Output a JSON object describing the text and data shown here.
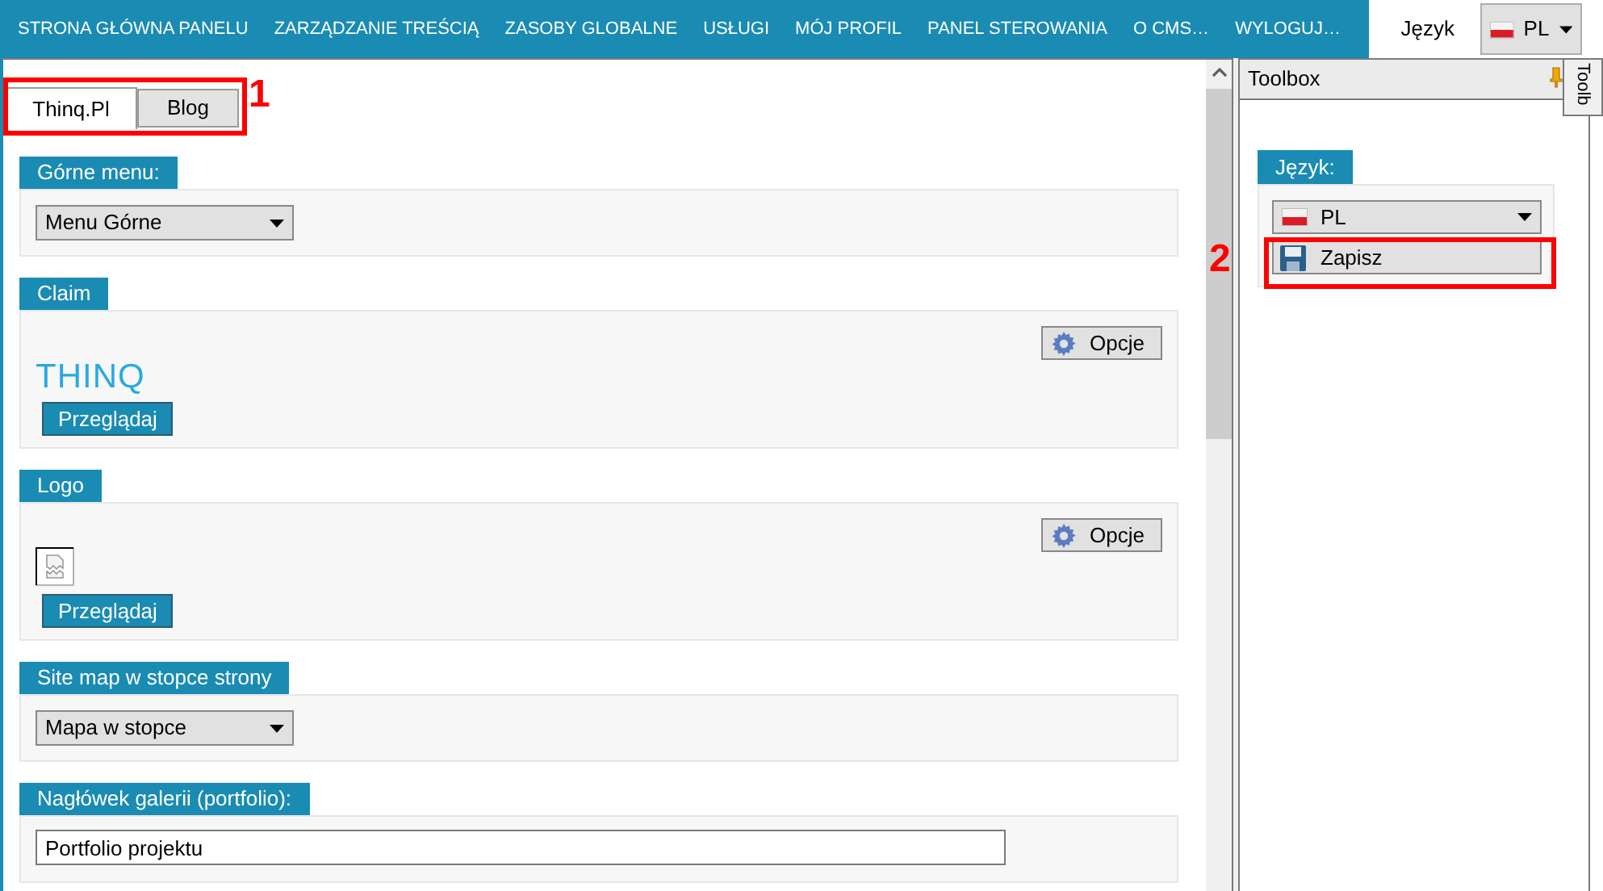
{
  "nav": {
    "items": [
      {
        "label": "STRONA GŁÓWNA PANELU"
      },
      {
        "label": "ZARZĄDZANIE TREŚCIĄ"
      },
      {
        "label": "ZASOBY GLOBALNE"
      },
      {
        "label": "USŁUGI"
      },
      {
        "label": "MÓJ PROFIL"
      },
      {
        "label": "PANEL STEROWANIA"
      },
      {
        "label": "O CMS…"
      },
      {
        "label": "WYLOGUJ…"
      }
    ],
    "language_label": "Język",
    "language": {
      "value": "PL"
    }
  },
  "tabs": [
    {
      "label": "Thinq.Pl",
      "selected": true
    },
    {
      "label": "Blog",
      "selected": false
    }
  ],
  "sections": [
    {
      "kind": "select",
      "title": "Górne menu:",
      "value": "Menu Górne"
    },
    {
      "kind": "image",
      "title": "Claim",
      "options": "Opcje",
      "preview": "THINQ",
      "browse": "Przeglądaj"
    },
    {
      "kind": "image",
      "title": "Logo",
      "options": "Opcje",
      "browse": "Przeglądaj"
    },
    {
      "kind": "select",
      "title": "Site map w stopce strony",
      "value": "Mapa w stopce"
    },
    {
      "kind": "input",
      "title": "Nagłówek galerii (portfolio):",
      "value": "Portfolio projektu"
    }
  ],
  "toolbox": {
    "title": "Toolbox",
    "side_tab": "Toolb",
    "section_title": "Język:",
    "language": {
      "value": "PL"
    },
    "save": "Zapisz"
  },
  "annotations": [
    {
      "label": "1"
    },
    {
      "label": "2"
    }
  ]
}
